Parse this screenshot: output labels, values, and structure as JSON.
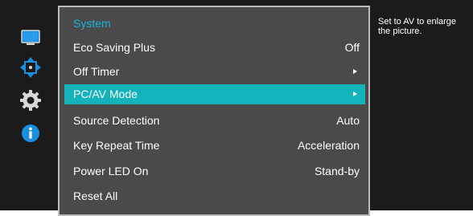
{
  "sidebar": {
    "icons": [
      "monitor-icon",
      "resize-arrows-icon",
      "gear-icon",
      "info-icon"
    ],
    "accent_color": "#1a8fe0"
  },
  "menu": {
    "title": "System",
    "title_color": "#1ab3e3",
    "selected_color": "#13b3b9",
    "items": [
      {
        "label": "Eco Saving Plus",
        "value": "Off"
      },
      {
        "label": "Off Timer",
        "value": ""
      },
      {
        "label": "PC/AV Mode",
        "value": ""
      },
      {
        "label": "Source Detection",
        "value": "Auto"
      },
      {
        "label": "Key Repeat Time",
        "value": "Acceleration"
      },
      {
        "label": "Power LED On",
        "value": "Stand-by"
      },
      {
        "label": "Reset All",
        "value": ""
      }
    ],
    "selected_index": 2
  },
  "help": {
    "text": "Set to AV to enlarge the picture."
  }
}
